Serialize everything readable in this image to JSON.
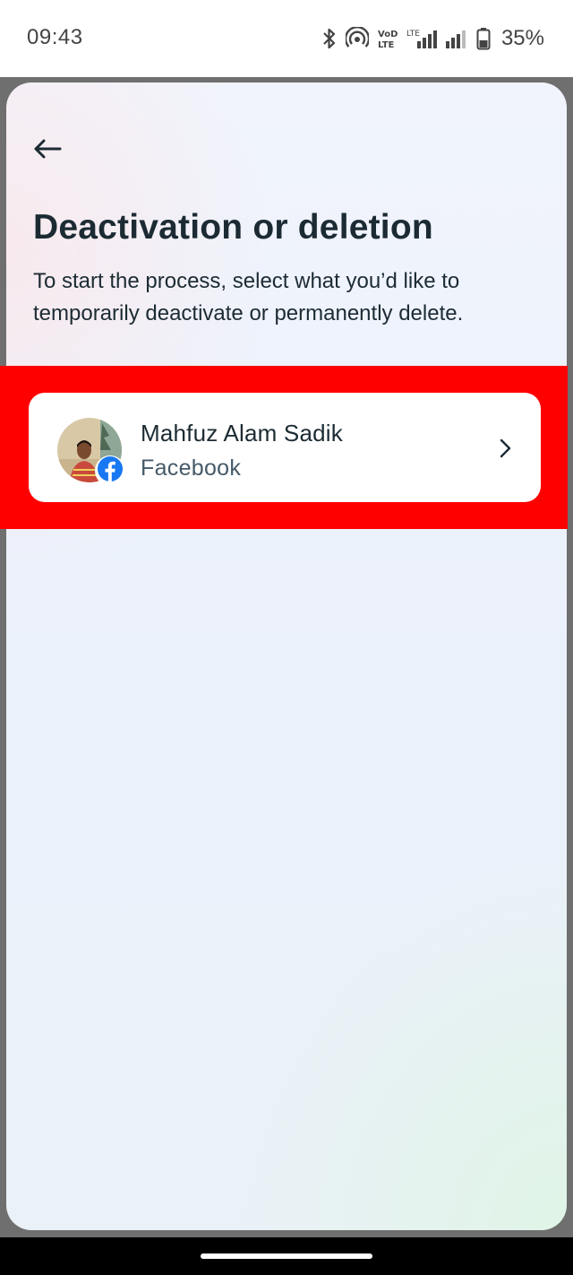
{
  "status_bar": {
    "time": "09:43",
    "battery_percent": "35%",
    "icons": [
      "bluetooth-icon",
      "hotspot-icon",
      "volte-icon",
      "lte-signal-icon",
      "signal-icon",
      "battery-icon"
    ]
  },
  "header": {
    "back_icon": "arrow-left-icon"
  },
  "main": {
    "title": "Deactivation or deletion",
    "description": "To start the process, select what you’d like to temporarily deactivate or permanently delete."
  },
  "account": {
    "name": "Mahfuz Alam Sadik",
    "platform": "Facebook",
    "badge_icon": "facebook-icon",
    "chevron_icon": "chevron-right-icon"
  },
  "colors": {
    "highlight": "#ff0000",
    "facebook_blue": "#1877f2",
    "text_primary": "#1c2b33",
    "text_secondary": "#465a69"
  }
}
